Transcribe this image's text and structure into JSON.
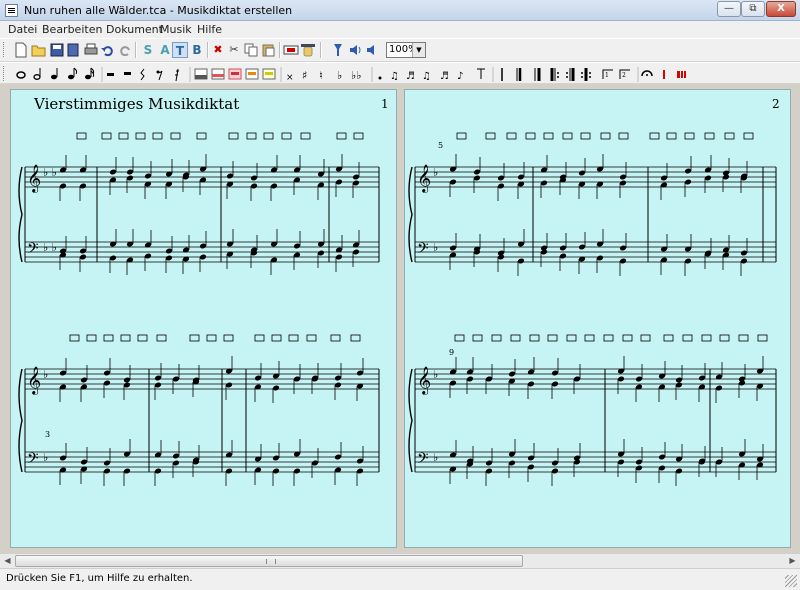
{
  "window": {
    "title": "Nun ruhen alle Wälder.tca - Musikdiktat erstellen",
    "minimize": "—",
    "restore": "⧉",
    "close": "X"
  },
  "menu": [
    "Datei",
    "Bearbeiten",
    "Dokument",
    "Musik",
    "Hilfe"
  ],
  "toolbar1": {
    "voice_letters": [
      "S",
      "A",
      "T",
      "B"
    ],
    "zoom": "100%"
  },
  "score": {
    "title": "Vierstimmiges Musikdiktat",
    "page_numbers": [
      "1",
      "2"
    ],
    "measure_numbers": [
      "5",
      "3",
      "9"
    ]
  },
  "status": {
    "text": "Drücken Sie F1, um Hilfe zu erhalten."
  }
}
